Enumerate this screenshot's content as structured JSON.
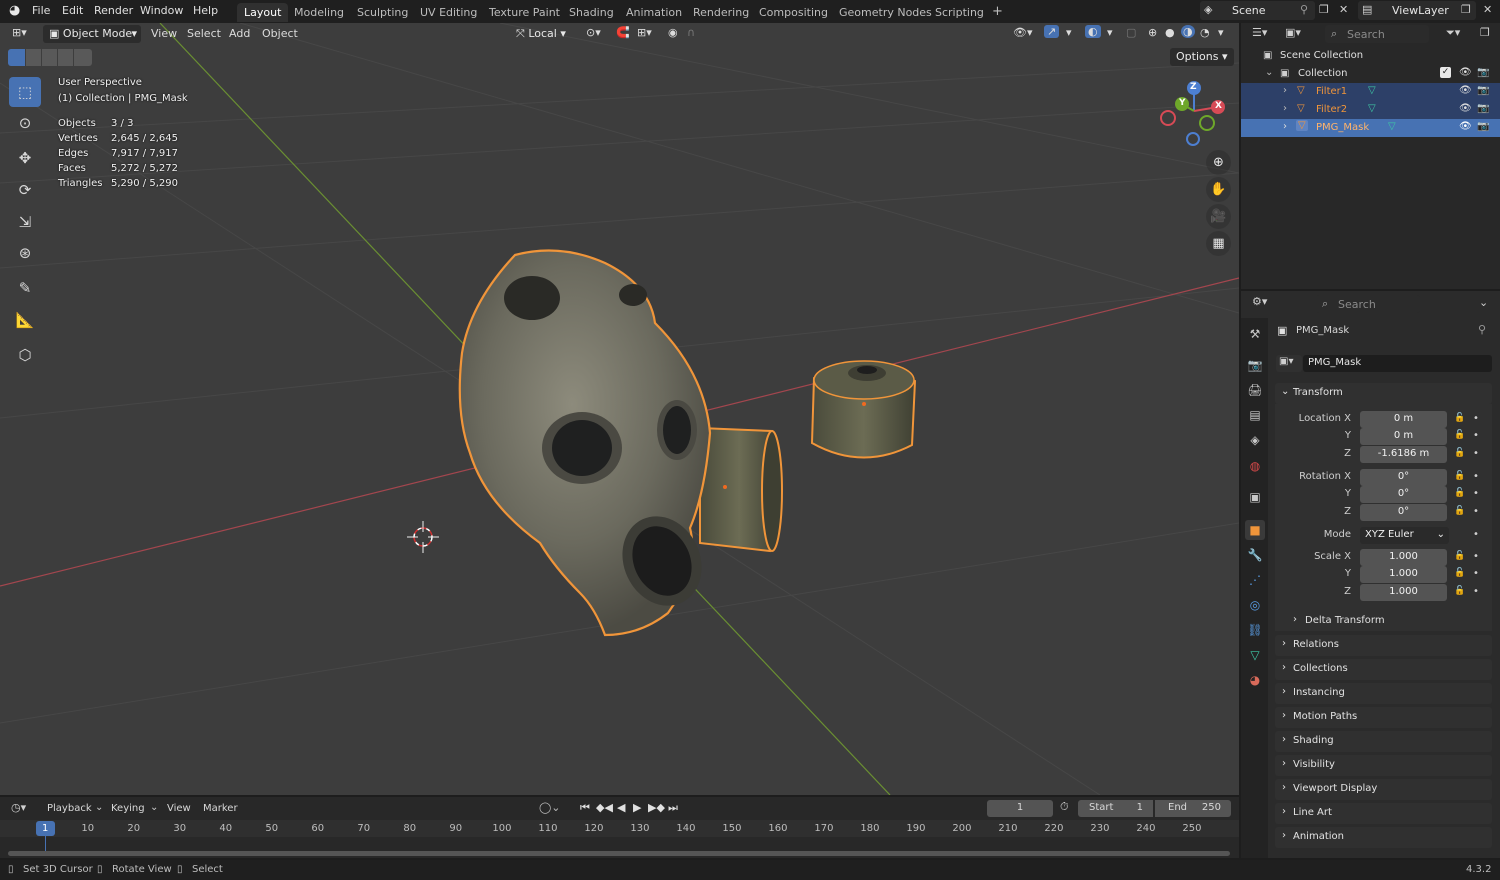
{
  "top_menu": [
    "File",
    "Edit",
    "Render",
    "Window",
    "Help"
  ],
  "workspaces": [
    "Layout",
    "Modeling",
    "Sculpting",
    "UV Editing",
    "Texture Paint",
    "Shading",
    "Animation",
    "Rendering",
    "Compositing",
    "Geometry Nodes",
    "Scripting"
  ],
  "add_workspace": "+",
  "scene_name": "Scene",
  "view_layer": "ViewLayer",
  "viewport": {
    "mode": "Object Mode",
    "menus": [
      "View",
      "Select",
      "Add",
      "Object"
    ],
    "orientation": "Local",
    "options": "Options",
    "perspective": "User Perspective",
    "collection_info": "(1) Collection | PMG_Mask",
    "stats": [
      {
        "label": "Objects",
        "value": "3 / 3"
      },
      {
        "label": "Vertices",
        "value": "2,645 / 2,645"
      },
      {
        "label": "Edges",
        "value": "7,917 / 7,917"
      },
      {
        "label": "Faces",
        "value": "5,272 / 5,272"
      },
      {
        "label": "Triangles",
        "value": "5,290 / 5,290"
      }
    ],
    "gizmo_axes": [
      "X",
      "Y",
      "Z"
    ]
  },
  "outliner": {
    "search_placeholder": "Search",
    "scene_collection": "Scene Collection",
    "collection": "Collection",
    "objects": [
      "Filter1",
      "Filter2",
      "PMG_Mask"
    ]
  },
  "properties": {
    "search_placeholder": "Search",
    "object_name": "PMG_Mask",
    "object_field": "PMG_Mask",
    "transform_title": "Transform",
    "location": {
      "x_label": "Location X",
      "y_label": "Y",
      "z_label": "Z",
      "x": "0 m",
      "y": "0 m",
      "z": "-1.6186 m"
    },
    "rotation": {
      "x_label": "Rotation X",
      "y_label": "Y",
      "z_label": "Z",
      "x": "0°",
      "y": "0°",
      "z": "0°"
    },
    "mode_label": "Mode",
    "mode_value": "XYZ Euler",
    "scale": {
      "x_label": "Scale X",
      "y_label": "Y",
      "z_label": "Z",
      "x": "1.000",
      "y": "1.000",
      "z": "1.000"
    },
    "delta_transform": "Delta Transform",
    "panels": [
      "Relations",
      "Collections",
      "Instancing",
      "Motion Paths",
      "Shading",
      "Visibility",
      "Viewport Display",
      "Line Art",
      "Animation"
    ]
  },
  "timeline": {
    "menus": [
      "Playback",
      "Keying",
      "View",
      "Marker"
    ],
    "current_frame": "1",
    "start_label": "Start",
    "start": "1",
    "end_label": "End",
    "end": "250",
    "ruler": [
      "1",
      "10",
      "20",
      "30",
      "40",
      "50",
      "60",
      "70",
      "80",
      "90",
      "100",
      "110",
      "120",
      "130",
      "140",
      "150",
      "160",
      "170",
      "180",
      "190",
      "200",
      "210",
      "220",
      "230",
      "240",
      "250"
    ]
  },
  "status": {
    "items": [
      "Set 3D Cursor",
      "Rotate View",
      "Select"
    ],
    "version": "4.3.2"
  }
}
